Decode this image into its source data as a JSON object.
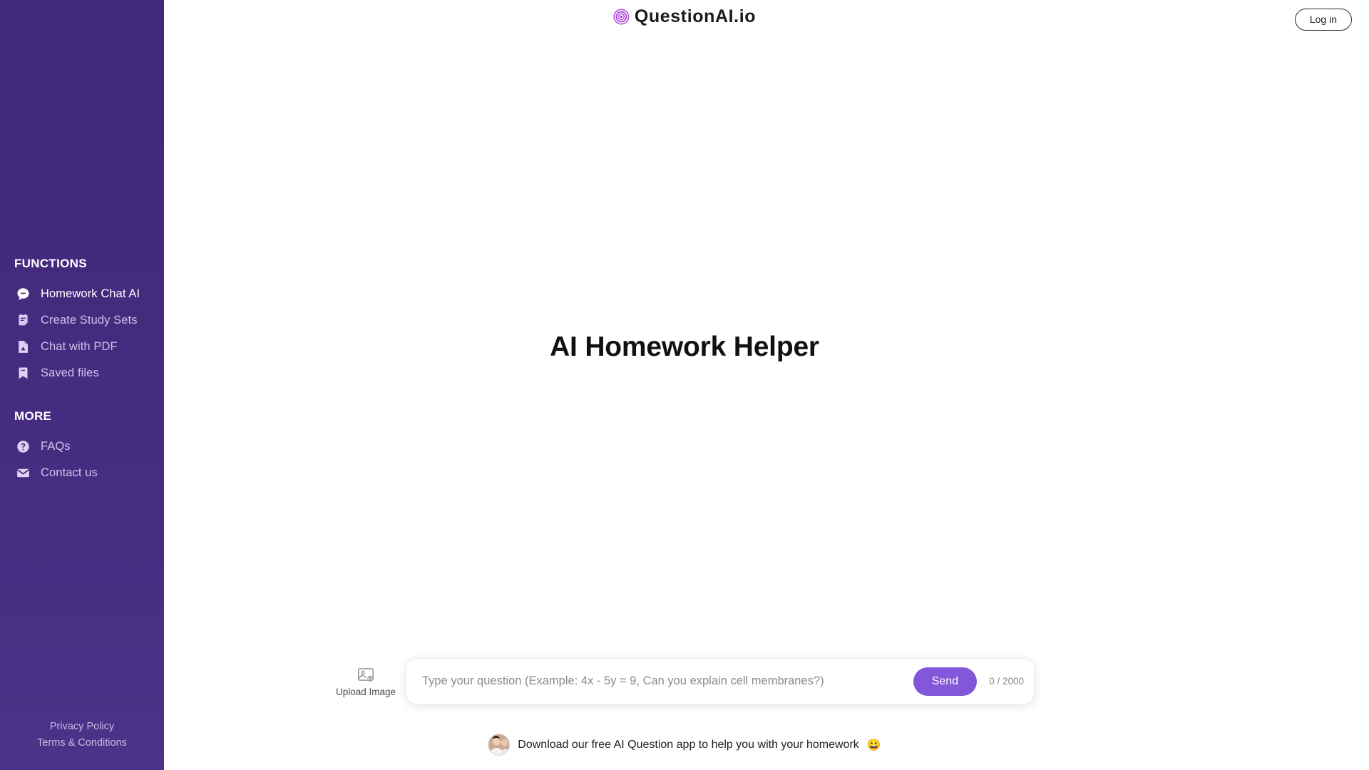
{
  "brand": {
    "name": "QuestionAI.io",
    "logo_icon": "target-concentric-circles-icon",
    "logo_color": "#b23bd4"
  },
  "header": {
    "login_label": "Log in"
  },
  "sidebar": {
    "accent_color": "#452a7e",
    "sections": [
      {
        "title": "FUNCTIONS",
        "items": [
          {
            "label": "Homework Chat AI",
            "icon": "chat-bubble-icon",
            "active": true
          },
          {
            "label": "Create Study Sets",
            "icon": "clipboard-notes-icon",
            "active": false
          },
          {
            "label": "Chat with PDF",
            "icon": "pdf-document-icon",
            "active": false
          },
          {
            "label": "Saved files",
            "icon": "bookmark-icon",
            "active": false
          }
        ]
      },
      {
        "title": "MORE",
        "items": [
          {
            "label": "FAQs",
            "icon": "question-circle-icon",
            "active": false
          },
          {
            "label": "Contact us",
            "icon": "envelope-icon",
            "active": false
          }
        ]
      }
    ],
    "footer_links": [
      {
        "label": "Privacy Policy"
      },
      {
        "label": "Terms & Conditions"
      }
    ]
  },
  "main": {
    "hero_title": "AI Homework Helper",
    "composer": {
      "upload_label": "Upload Image",
      "upload_icon": "image-upload-icon",
      "input_value": "",
      "input_placeholder": "Type your question (Example: 4x - 5y = 9, Can you explain cell membranes?)",
      "send_label": "Send",
      "send_color": "#8257d9",
      "char_counter": "0 / 2000"
    },
    "download_banner": {
      "avatar_icon": "user-photo-avatar",
      "text": "Download our free AI Question app to help you with your homework",
      "emoji": "😀"
    }
  }
}
